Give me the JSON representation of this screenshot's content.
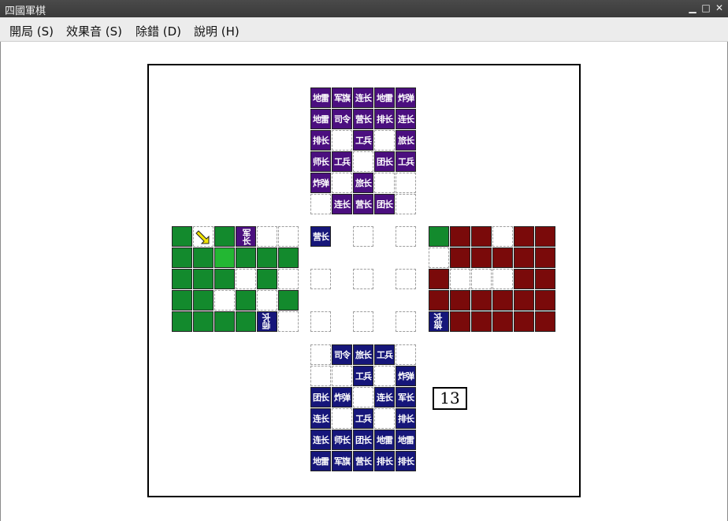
{
  "window": {
    "title": "四國軍棋",
    "controls": [
      "minimize",
      "maximize",
      "close"
    ]
  },
  "menu": [
    {
      "label": "開局 (S)"
    },
    {
      "label": "效果音 (S)"
    },
    {
      "label": "除錯 (D)"
    },
    {
      "label": "說明 (H)"
    }
  ],
  "colors": {
    "purple": "#4b0f7f",
    "navy": "#16167a",
    "green": "#138a2d",
    "red": "#7a0a0a",
    "green_selected": "#23b733"
  },
  "move_counter": "13",
  "board": {
    "north_purple": [
      [
        "地雷",
        "军旗",
        "连长",
        "地雷",
        "炸弹"
      ],
      [
        "地雷",
        "司令",
        "营长",
        "排长",
        "连长"
      ],
      [
        "排长",
        "",
        "工兵",
        "",
        "旅长"
      ],
      [
        "师长",
        "工兵",
        "",
        "团长",
        "工兵"
      ],
      [
        "炸弹",
        "",
        "旅长",
        "",
        ""
      ],
      [
        "",
        "连长",
        "营长",
        "团长",
        ""
      ]
    ],
    "south_navy": [
      [
        "",
        "司令",
        "旅长",
        "工兵",
        ""
      ],
      [
        "",
        "",
        "工兵",
        "",
        "炸弹"
      ],
      [
        "团长",
        "炸弹",
        "",
        "连长",
        "军长"
      ],
      [
        "连长",
        "",
        "工兵",
        "",
        "排长"
      ],
      [
        "连长",
        "师长",
        "团长",
        "地雷",
        "地雷"
      ],
      [
        "地雷",
        "军旗",
        "营长",
        "排长",
        "排长"
      ]
    ],
    "west_green_rows": [
      [
        "G",
        "A",
        "G",
        "军长",
        "",
        ""
      ],
      [
        "G",
        "G",
        "S",
        "G",
        "G",
        "G"
      ],
      [
        "G",
        "G",
        "G",
        "",
        "G",
        ""
      ],
      [
        "G",
        "G",
        "",
        "G",
        "",
        "G"
      ],
      [
        "G",
        "G",
        "G",
        "G",
        "师长",
        ""
      ]
    ],
    "east_red_rows": [
      [
        "G",
        "R",
        "R",
        "",
        "R",
        "R"
      ],
      [
        "",
        "R",
        "R",
        "R",
        "R",
        "R"
      ],
      [
        "R",
        "",
        "",
        "",
        "R",
        "R"
      ],
      [
        "R",
        "R",
        "R",
        "R",
        "R",
        "R"
      ],
      [
        "旅长",
        "R",
        "R",
        "R",
        "R",
        "R"
      ]
    ],
    "center_piece": "营长",
    "arrow_icon": "yellow-arrow-icon"
  }
}
